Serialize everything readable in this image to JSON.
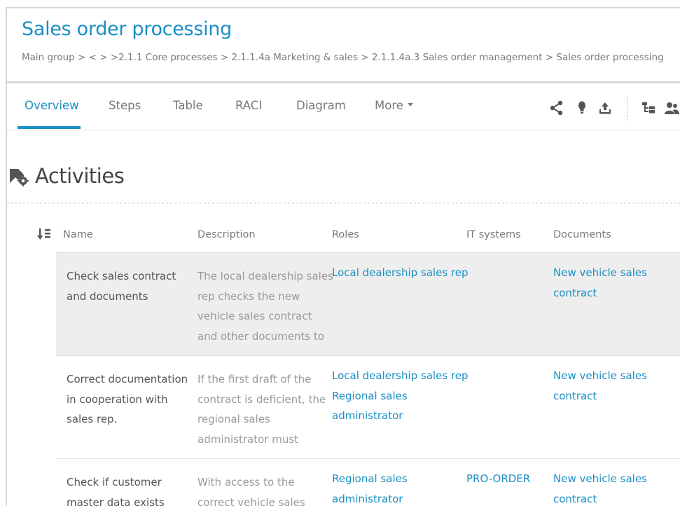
{
  "header": {
    "title": "Sales order processing",
    "breadcrumb": "Main group > < > >2.1.1 Core processes > 2.1.1.4a Marketing & sales > 2.1.1.4a.3 Sales order management > Sales order processing"
  },
  "tabs": [
    {
      "label": "Overview",
      "active": true
    },
    {
      "label": "Steps"
    },
    {
      "label": "Table"
    },
    {
      "label": "RACI"
    },
    {
      "label": "Diagram"
    },
    {
      "label": "More"
    }
  ],
  "toolbar": {
    "icons": [
      "share-icon",
      "lightbulb-icon",
      "upload-icon",
      "hierarchy-icon",
      "users-icon"
    ]
  },
  "section": {
    "title": "Activities",
    "icon": "activities-gear-icon"
  },
  "table": {
    "columns": [
      "Name",
      "Description",
      "Roles",
      "IT systems",
      "Documents"
    ],
    "rows": [
      {
        "name": [
          "Check sales contract",
          "and documents"
        ],
        "description": [
          "The local dealership sales",
          "rep checks the new",
          "vehicle sales contract",
          "and other documents to"
        ],
        "roles": [
          "Local dealership sales rep"
        ],
        "it_systems": [],
        "documents": [
          "New vehicle sales",
          "contract"
        ]
      },
      {
        "name": [
          "Correct documentation",
          "in cooperation with",
          "sales rep."
        ],
        "description": [
          "If the first draft of the",
          "contract is deficient, the",
          "regional sales",
          "administrator must"
        ],
        "roles": [
          "Local dealership sales rep",
          "Regional sales",
          "administrator"
        ],
        "it_systems": [],
        "documents": [
          "New vehicle sales",
          "contract"
        ]
      },
      {
        "name": [
          "Check if customer",
          "master data exists"
        ],
        "description": [
          "With access to the",
          "correct vehicle sales"
        ],
        "roles": [
          "Regional sales",
          "administrator"
        ],
        "it_systems": [
          "PRO-ORDER"
        ],
        "documents": [
          "New vehicle sales",
          "contract"
        ]
      }
    ]
  },
  "colors": {
    "accent": "#1a8fc4",
    "row_highlight": "#eeeeee",
    "muted_text": "#9a9a9a"
  }
}
